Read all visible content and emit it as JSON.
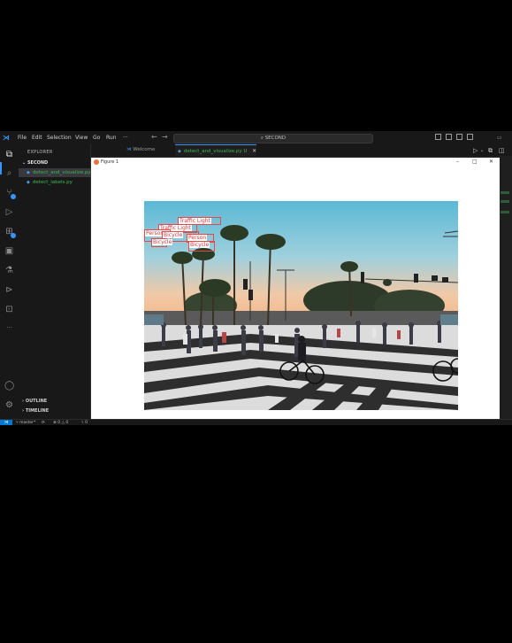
{
  "titlebar": {
    "menu": [
      "File",
      "Edit",
      "Selection",
      "View",
      "Go",
      "Run",
      "···"
    ],
    "search_text": "SECOND",
    "icons": [
      "vscode-logo",
      "back-arrow",
      "forward-arrow",
      "layout-icons",
      "minimize",
      "maximize",
      "close"
    ]
  },
  "sidebar": {
    "title": "EXPLORER",
    "more": "···",
    "folder": "SECOND",
    "files": [
      {
        "name": "detect_and_visualize.py",
        "selected": true
      },
      {
        "name": "detect_labels.py",
        "selected": false
      }
    ],
    "outline": "OUTLINE",
    "timeline": "TIMELINE"
  },
  "tabs": [
    {
      "label": "Welcome",
      "active": false
    },
    {
      "label": "detect_and_visualize.py",
      "suffix": "U",
      "active": true
    }
  ],
  "figure": {
    "title": "Figure 1",
    "controls": [
      "–",
      "□",
      "✕"
    ],
    "detections": [
      {
        "label": "Traffic Light"
      },
      {
        "label": "Traffic Light"
      },
      {
        "label": "Person"
      },
      {
        "label": "Bicycle"
      },
      {
        "label": "Person"
      },
      {
        "label": "Bicycle"
      },
      {
        "label": "Bicycle"
      }
    ]
  },
  "statusbar": {
    "branch": "master*",
    "errors": "0",
    "warnings": "0",
    "ports": "0"
  },
  "colors": {
    "accent": "#3794ff",
    "box": "#e04a4a",
    "untracked": "#3fb950"
  }
}
